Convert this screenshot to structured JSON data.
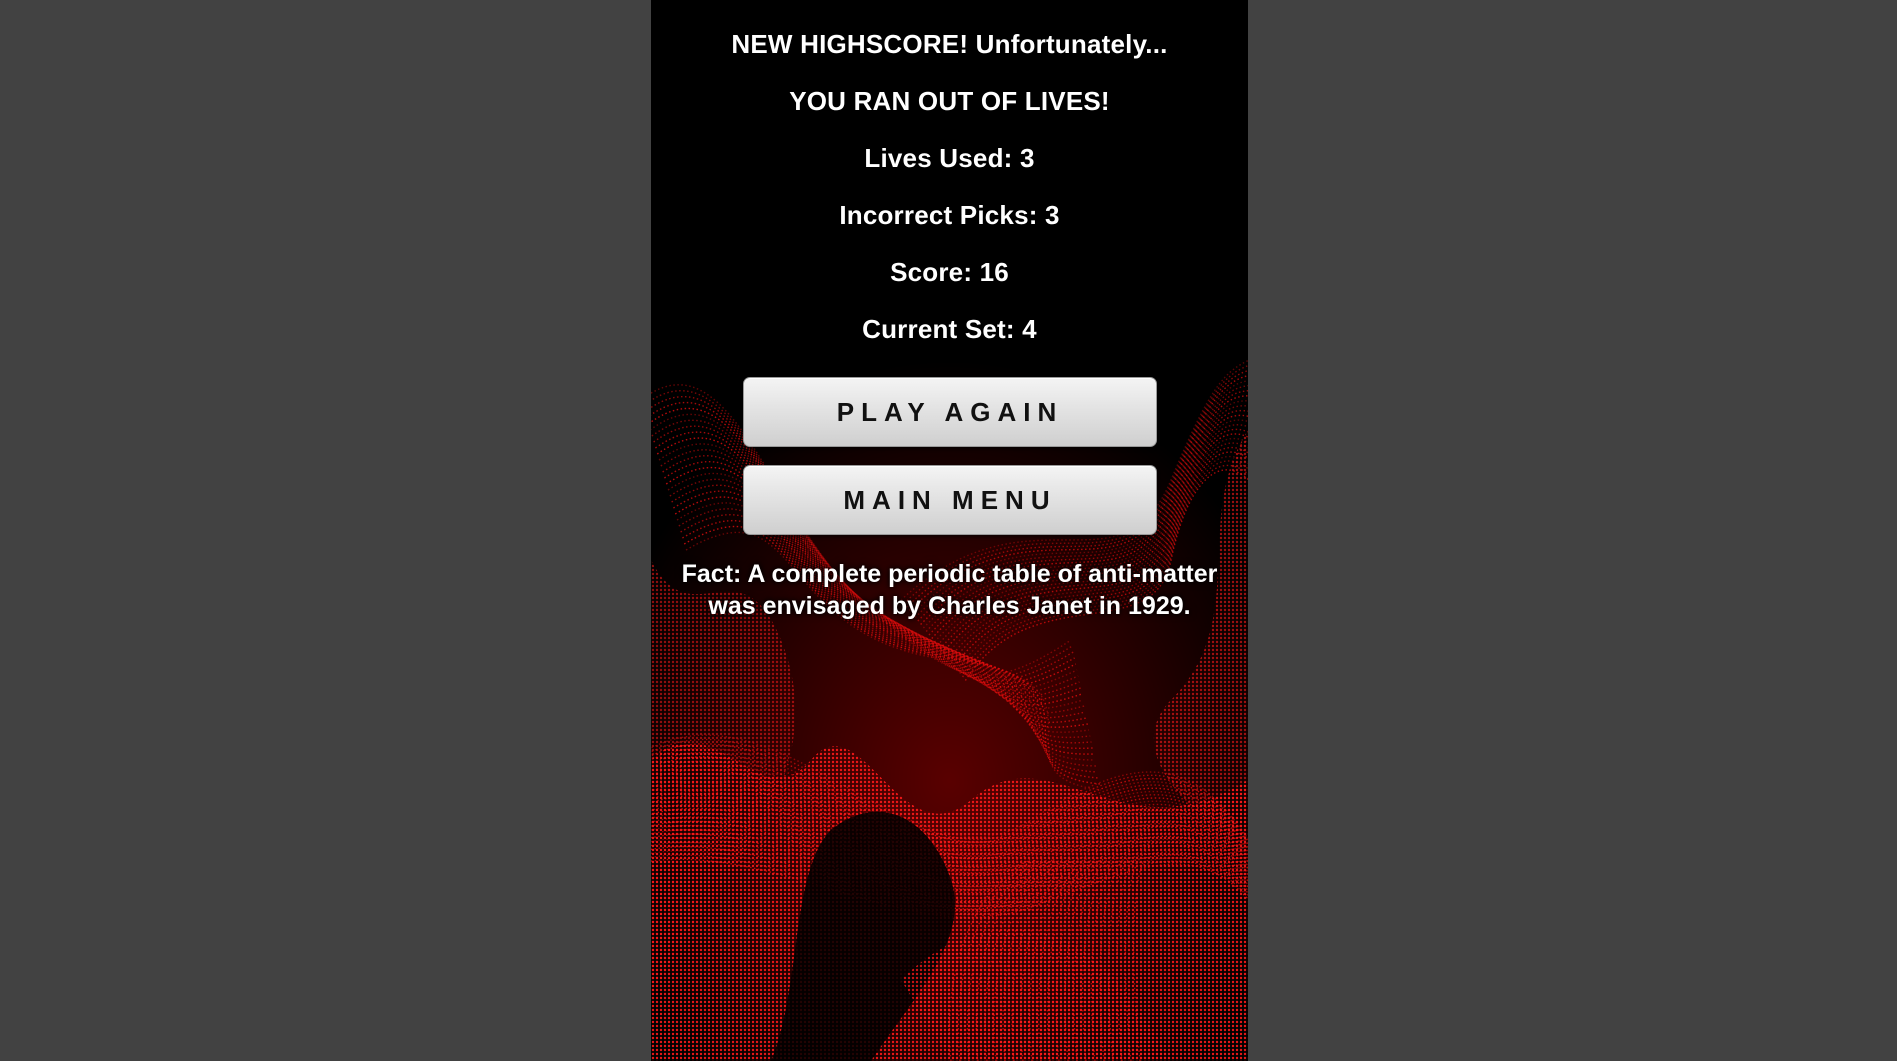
{
  "colors": {
    "outer_background": "#424242",
    "screen_background": "#000000",
    "wave_color": "#ff1010",
    "text": "#ffffff",
    "button_face": "#e3e3e3",
    "button_text": "#111111"
  },
  "results": {
    "highscore_message": "NEW HIGHSCORE! Unfortunately...",
    "game_over_message": "YOU RAN OUT OF LIVES!",
    "lives_used": "Lives Used: 3",
    "incorrect_picks": "Incorrect Picks: 3",
    "score": "Score: 16",
    "current_set": "Current Set: 4"
  },
  "buttons": {
    "play_again": "PLAY AGAIN",
    "main_menu": "MAIN MENU"
  },
  "fact": {
    "line1": "Fact: A complete periodic table of anti-matter",
    "line2": "was envisaged by Charles Janet in 1929."
  },
  "background": {
    "icon": "red-particle-wave-art"
  }
}
